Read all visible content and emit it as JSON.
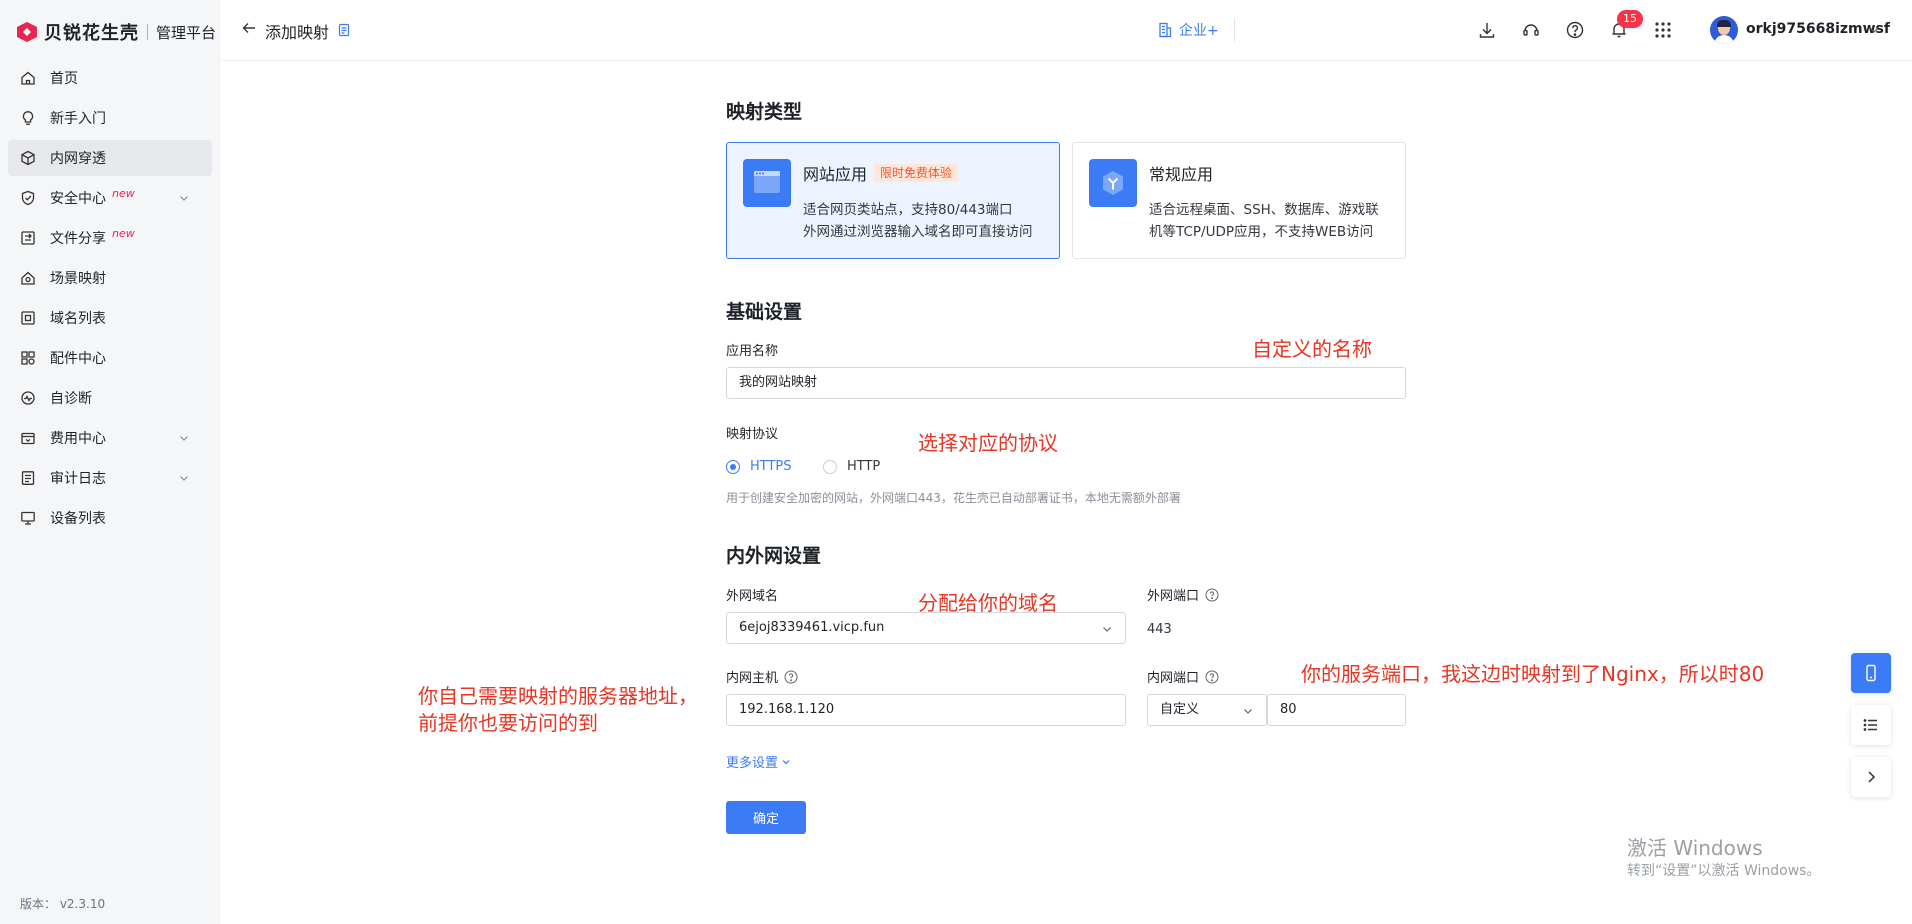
{
  "brand": {
    "name": "贝锐花生壳",
    "subtitle": "管理平台"
  },
  "sidebar": {
    "items": [
      {
        "label": "首页",
        "icon": "home-icon"
      },
      {
        "label": "新手入门",
        "icon": "lightbulb-icon"
      },
      {
        "label": "内网穿透",
        "icon": "cube-icon",
        "active": true
      },
      {
        "label": "安全中心",
        "icon": "shield-icon",
        "badge": "new",
        "expandable": true
      },
      {
        "label": "文件分享",
        "icon": "file-share-icon",
        "badge": "new"
      },
      {
        "label": "场景映射",
        "icon": "scene-icon"
      },
      {
        "label": "域名列表",
        "icon": "domain-icon"
      },
      {
        "label": "配件中心",
        "icon": "apps-icon"
      },
      {
        "label": "自诊断",
        "icon": "diagnose-icon"
      },
      {
        "label": "费用中心",
        "icon": "wallet-icon",
        "expandable": true
      },
      {
        "label": "审计日志",
        "icon": "log-icon",
        "expandable": true
      },
      {
        "label": "设备列表",
        "icon": "monitor-icon"
      }
    ],
    "version": "版本： v2.3.10"
  },
  "header": {
    "title": "添加映射",
    "enterprise_label": "企业+",
    "notification_count": "15",
    "username": "orkj975668izmwsf"
  },
  "form": {
    "mapping_type": {
      "title": "映射类型",
      "options": [
        {
          "name": "网站应用",
          "tag": "限时免费体验",
          "desc1": "适合网页类站点，支持80/443端口",
          "desc2": "外网通过浏览器输入域名即可直接访问",
          "selected": true
        },
        {
          "name": "常规应用",
          "desc1": "适合远程桌面、SSH、数据库、游戏联",
          "desc2": "机等TCP/UDP应用，不支持WEB访问",
          "selected": false
        }
      ]
    },
    "basic": {
      "title": "基础设置",
      "app_name_label": "应用名称",
      "app_name_value": "我的网站映射",
      "protocol_label": "映射协议",
      "protocol_options": [
        "HTTPS",
        "HTTP"
      ],
      "protocol_selected": "HTTPS",
      "protocol_hint": "用于创建安全加密的网站，外网端口443，花生壳已自动部署证书，本地无需额外部署"
    },
    "network": {
      "title": "内外网设置",
      "domain_label": "外网域名",
      "domain_value": "6ejoj8339461.vicp.fun",
      "ext_port_label": "外网端口",
      "ext_port_value": "443",
      "host_label": "内网主机",
      "host_value": "192.168.1.120",
      "int_port_label": "内网端口",
      "int_port_mode": "自定义",
      "int_port_value": "80"
    },
    "more_settings": "更多设置",
    "submit": "确定"
  },
  "annotations": {
    "name": "自定义的名称",
    "protocol": "选择对应的协议",
    "domain": "分配给你的域名",
    "port": "你的服务端口，我这边时映射到了Nginx，所以时80",
    "host_line1": "你自己需要映射的服务器地址，",
    "host_line2": "前提你也要访问的到"
  },
  "watermark": {
    "line1": "激活 Windows",
    "line2": "转到“设置”以激活 Windows。"
  },
  "colors": {
    "primary": "#3b7bf6",
    "brand": "#e8254f",
    "annotation": "#e83524",
    "tag_bg": "#ffe6da",
    "tag_text": "#f4572c"
  }
}
